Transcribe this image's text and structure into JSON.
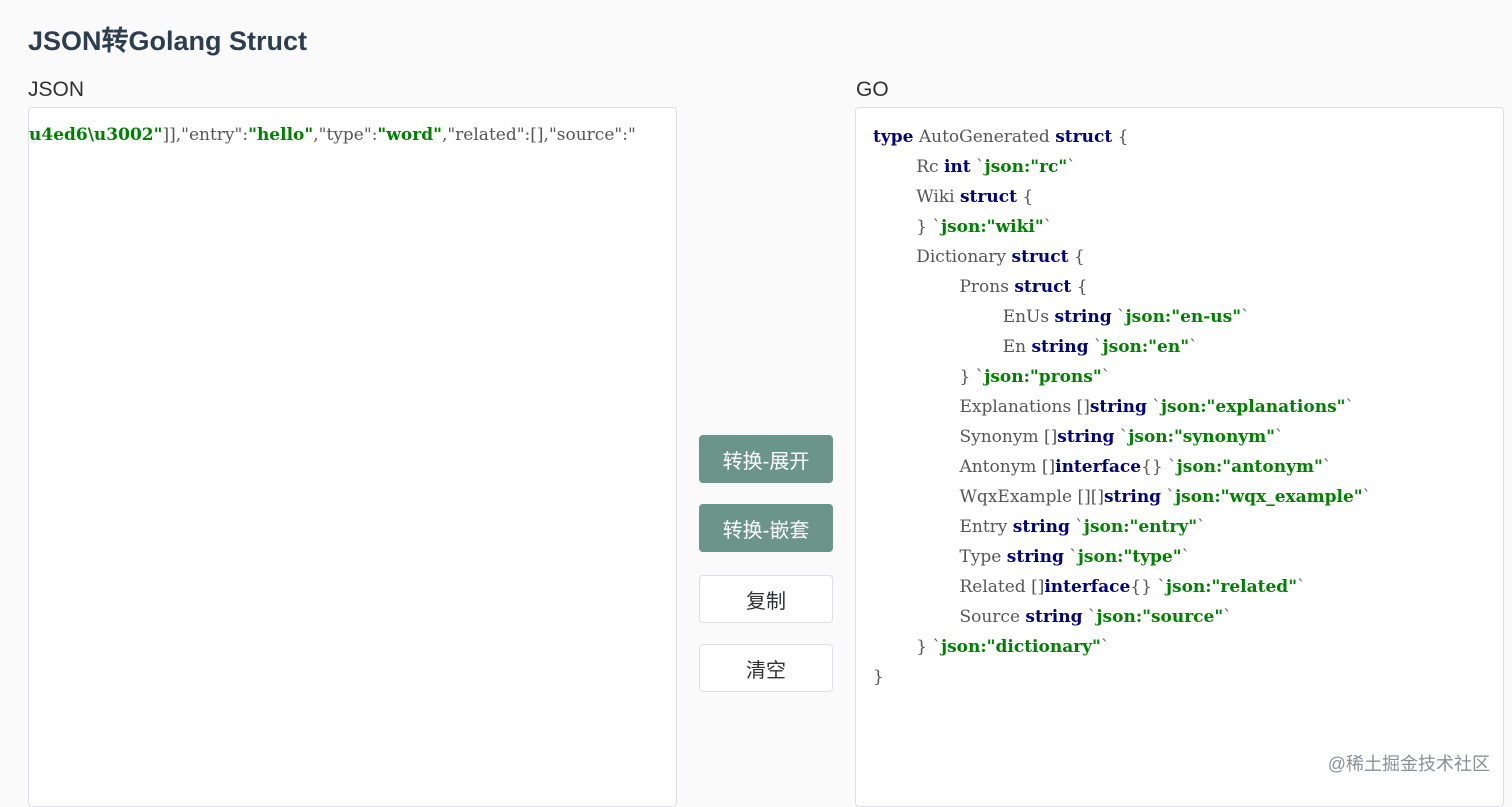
{
  "page": {
    "title": "JSON转Golang Struct"
  },
  "json_pane": {
    "label": "JSON",
    "line": [
      {
        "t": "u4ed6\\u3002\"",
        "c": "s"
      },
      {
        "t": "]],",
        "c": "p"
      },
      {
        "t": "\"entry\"",
        "c": "p"
      },
      {
        "t": ":",
        "c": "p"
      },
      {
        "t": "\"hello\"",
        "c": "s"
      },
      {
        "t": ",",
        "c": "p"
      },
      {
        "t": "\"type\"",
        "c": "p"
      },
      {
        "t": ":",
        "c": "p"
      },
      {
        "t": "\"word\"",
        "c": "s"
      },
      {
        "t": ",",
        "c": "p"
      },
      {
        "t": "\"related\"",
        "c": "p"
      },
      {
        "t": ":[],",
        "c": "p"
      },
      {
        "t": "\"source\"",
        "c": "p"
      },
      {
        "t": ":\"",
        "c": "p"
      }
    ]
  },
  "go_pane": {
    "label": "GO",
    "lines": [
      [
        {
          "t": "type",
          "c": "k"
        },
        {
          "t": " AutoGenerated ",
          "c": "p"
        },
        {
          "t": "struct",
          "c": "k"
        },
        {
          "t": " {",
          "c": "p"
        }
      ],
      [
        {
          "t": "        Rc ",
          "c": "p"
        },
        {
          "t": "int",
          "c": "k"
        },
        {
          "t": " `",
          "c": "p"
        },
        {
          "t": "json:\"rc\"",
          "c": "s"
        },
        {
          "t": "`",
          "c": "p"
        }
      ],
      [
        {
          "t": "        Wiki ",
          "c": "p"
        },
        {
          "t": "struct",
          "c": "k"
        },
        {
          "t": " {",
          "c": "p"
        }
      ],
      [
        {
          "t": "        } `",
          "c": "p"
        },
        {
          "t": "json:\"wiki\"",
          "c": "s"
        },
        {
          "t": "`",
          "c": "p"
        }
      ],
      [
        {
          "t": "        Dictionary ",
          "c": "p"
        },
        {
          "t": "struct",
          "c": "k"
        },
        {
          "t": " {",
          "c": "p"
        }
      ],
      [
        {
          "t": "                Prons ",
          "c": "p"
        },
        {
          "t": "struct",
          "c": "k"
        },
        {
          "t": " {",
          "c": "p"
        }
      ],
      [
        {
          "t": "                        EnUs ",
          "c": "p"
        },
        {
          "t": "string",
          "c": "k"
        },
        {
          "t": " `",
          "c": "p"
        },
        {
          "t": "json:\"en-us\"",
          "c": "s"
        },
        {
          "t": "`",
          "c": "p"
        }
      ],
      [
        {
          "t": "                        En ",
          "c": "p"
        },
        {
          "t": "string",
          "c": "k"
        },
        {
          "t": " `",
          "c": "p"
        },
        {
          "t": "json:\"en\"",
          "c": "s"
        },
        {
          "t": "`",
          "c": "p"
        }
      ],
      [
        {
          "t": "                } `",
          "c": "p"
        },
        {
          "t": "json:\"prons\"",
          "c": "s"
        },
        {
          "t": "`",
          "c": "p"
        }
      ],
      [
        {
          "t": "                Explanations []",
          "c": "p"
        },
        {
          "t": "string",
          "c": "k"
        },
        {
          "t": " `",
          "c": "p"
        },
        {
          "t": "json:\"explanations\"",
          "c": "s"
        },
        {
          "t": "`",
          "c": "p"
        }
      ],
      [
        {
          "t": "                Synonym []",
          "c": "p"
        },
        {
          "t": "string",
          "c": "k"
        },
        {
          "t": " `",
          "c": "p"
        },
        {
          "t": "json:\"synonym\"",
          "c": "s"
        },
        {
          "t": "`",
          "c": "p"
        }
      ],
      [
        {
          "t": "                Antonym []",
          "c": "p"
        },
        {
          "t": "interface",
          "c": "k"
        },
        {
          "t": "{} `",
          "c": "p"
        },
        {
          "t": "json:\"antonym\"",
          "c": "s"
        },
        {
          "t": "`",
          "c": "p"
        }
      ],
      [
        {
          "t": "                WqxExample [][]",
          "c": "p"
        },
        {
          "t": "string",
          "c": "k"
        },
        {
          "t": " `",
          "c": "p"
        },
        {
          "t": "json:\"wqx_example\"",
          "c": "s"
        },
        {
          "t": "`",
          "c": "p"
        }
      ],
      [
        {
          "t": "                Entry ",
          "c": "p"
        },
        {
          "t": "string",
          "c": "k"
        },
        {
          "t": " `",
          "c": "p"
        },
        {
          "t": "json:\"entry\"",
          "c": "s"
        },
        {
          "t": "`",
          "c": "p"
        }
      ],
      [
        {
          "t": "                Type ",
          "c": "p"
        },
        {
          "t": "string",
          "c": "k"
        },
        {
          "t": " `",
          "c": "p"
        },
        {
          "t": "json:\"type\"",
          "c": "s"
        },
        {
          "t": "`",
          "c": "p"
        }
      ],
      [
        {
          "t": "                Related []",
          "c": "p"
        },
        {
          "t": "interface",
          "c": "k"
        },
        {
          "t": "{} `",
          "c": "p"
        },
        {
          "t": "json:\"related\"",
          "c": "s"
        },
        {
          "t": "`",
          "c": "p"
        }
      ],
      [
        {
          "t": "                Source ",
          "c": "p"
        },
        {
          "t": "string",
          "c": "k"
        },
        {
          "t": " `",
          "c": "p"
        },
        {
          "t": "json:\"source\"",
          "c": "s"
        },
        {
          "t": "`",
          "c": "p"
        }
      ],
      [
        {
          "t": "        } `",
          "c": "p"
        },
        {
          "t": "json:\"dictionary\"",
          "c": "s"
        },
        {
          "t": "`",
          "c": "p"
        }
      ],
      [
        {
          "t": "}",
          "c": "p"
        }
      ]
    ]
  },
  "actions": {
    "convert_expand": "转换-展开",
    "convert_nested": "转换-嵌套",
    "copy": "复制",
    "clear": "清空"
  },
  "watermark": "@稀土掘金技术社区",
  "colors": {
    "primary_button": "#6b958a",
    "keyword": "#000080",
    "string": "#008000",
    "punct": "#555555"
  }
}
